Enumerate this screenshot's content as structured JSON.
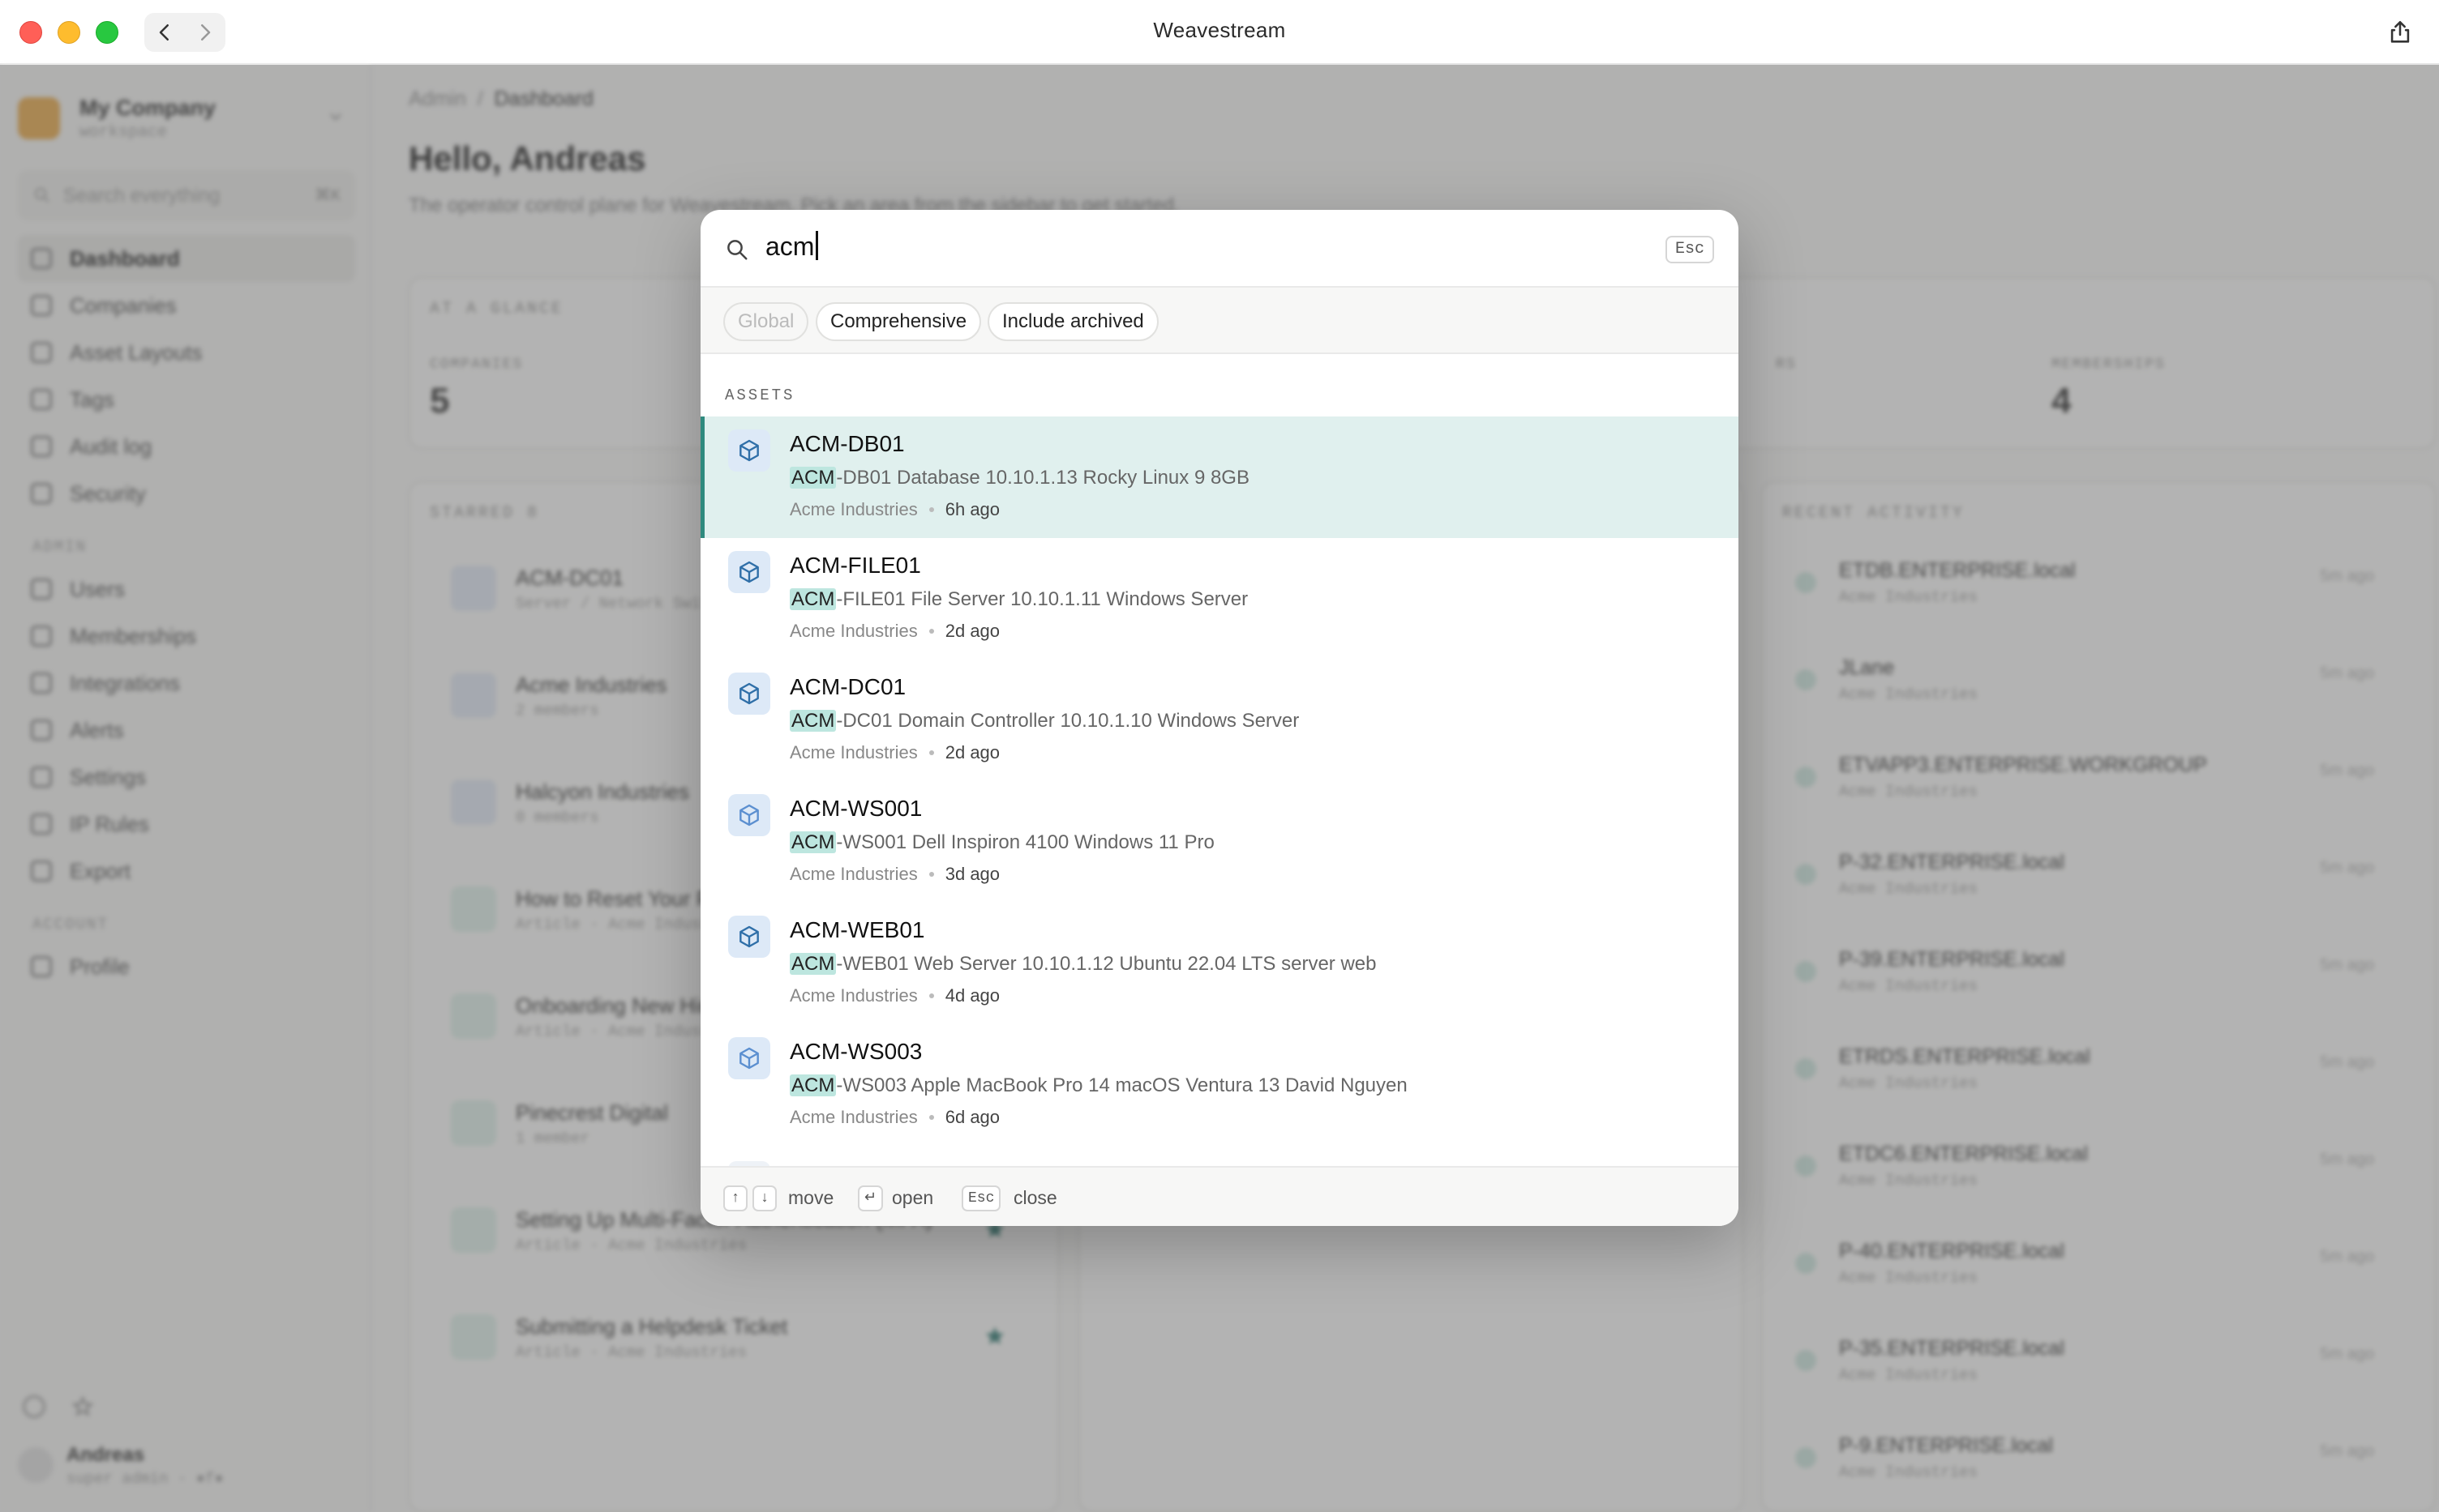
{
  "window": {
    "title": "Weavestream"
  },
  "sidebar": {
    "company_name": "My Company",
    "company_sub": "workspace",
    "search_placeholder": "Search everything",
    "search_shortcut": "⌘K",
    "items": [
      {
        "label": "Dashboard"
      },
      {
        "label": "Companies"
      },
      {
        "label": "Asset Layouts"
      },
      {
        "label": "Tags"
      },
      {
        "label": "Audit log"
      },
      {
        "label": "Security"
      }
    ],
    "admin_section": "ADMIN",
    "admin_items": [
      {
        "label": "Users"
      },
      {
        "label": "Memberships"
      },
      {
        "label": "Integrations"
      },
      {
        "label": "Alerts"
      },
      {
        "label": "Settings"
      },
      {
        "label": "IP Rules"
      },
      {
        "label": "Export"
      }
    ],
    "account_section": "ACCOUNT",
    "account_items": [
      {
        "label": "Profile"
      }
    ],
    "user_name": "Andreas",
    "user_role": "super admin · ●f●"
  },
  "main": {
    "breadcrumb_root": "Admin",
    "breadcrumb_current": "Dashboard",
    "greeting": "Hello, Andreas",
    "intro": "The operator control plane for Weavestream. Pick an area from the sidebar to get started.",
    "at_a_glance": "AT A GLANCE",
    "stats": [
      {
        "label": "COMPANIES",
        "value": "5"
      },
      {
        "label": "MEMBERSHIPS",
        "value": "4"
      }
    ],
    "stats_partial_label": "RS",
    "starred_label": "STARRED 8",
    "starred": [
      {
        "title": "ACM-DC01",
        "sub": "Server / Network Switch"
      },
      {
        "title": "Acme Industries",
        "sub": "2 members"
      },
      {
        "title": "Halcyon Industries",
        "sub": "0 members"
      },
      {
        "title": "How to Reset Your Password",
        "sub": "Article · Acme Industries"
      },
      {
        "title": "Onboarding New Hires",
        "sub": "Article · Acme Industries"
      },
      {
        "title": "Pinecrest Digital",
        "sub": "1 member"
      },
      {
        "title": "Setting Up Multi-Factor Authentication (MFA)",
        "sub": "Article · Acme Industries"
      },
      {
        "title": "Submitting a Helpdesk Ticket",
        "sub": "Article · Acme Industries"
      }
    ],
    "recent_label": "RECENT ACTIVITY",
    "recent": [
      {
        "title": "ETDB.ENTERPRISE.local",
        "sub": "Acme Industries",
        "ago": "5m ago"
      },
      {
        "title": "JLane",
        "sub": "Acme Industries",
        "ago": "5m ago"
      },
      {
        "title": "ETVAPP3.ENTERPRISE.WORKGROUP",
        "sub": "Acme Industries",
        "ago": "5m ago"
      },
      {
        "title": "P-32.ENTERPRISE.local",
        "sub": "Acme Industries",
        "ago": "5m ago"
      },
      {
        "title": "P-39.ENTERPRISE.local",
        "sub": "Acme Industries",
        "ago": "5m ago"
      },
      {
        "title": "ETRDS.ENTERPRISE.local",
        "sub": "Acme Industries",
        "ago": "5m ago"
      },
      {
        "title": "ETDC6.ENTERPRISE.local",
        "sub": "Acme Industries",
        "ago": "5m ago"
      },
      {
        "title": "P-40.ENTERPRISE.local",
        "sub": "Acme Industries",
        "ago": "5m ago"
      },
      {
        "title": "P-35.ENTERPRISE.local",
        "sub": "Acme Industries",
        "ago": "5m ago"
      },
      {
        "title": "P-9.ENTERPRISE.local",
        "sub": "Acme Industries",
        "ago": "5m ago"
      }
    ]
  },
  "palette": {
    "query": "acm",
    "esc_label": "Esc",
    "filters": [
      {
        "label": "Global",
        "disabled": true
      },
      {
        "label": "Comprehensive",
        "disabled": false
      },
      {
        "label": "Include archived",
        "disabled": false
      }
    ],
    "group_label": "ASSETS",
    "highlight": "ACM",
    "results": [
      {
        "title": "ACM-DB01",
        "desc_rest": "-DB01 Database 10.10.1.13 Rocky Linux 9 8GB",
        "company": "Acme Industries",
        "ago": "6h ago",
        "selected": true
      },
      {
        "title": "ACM-FILE01",
        "desc_rest": "-FILE01 File Server 10.10.1.11 Windows Server",
        "company": "Acme Industries",
        "ago": "2d ago",
        "selected": false
      },
      {
        "title": "ACM-DC01",
        "desc_rest": "-DC01 Domain Controller 10.10.1.10 Windows Server",
        "company": "Acme Industries",
        "ago": "2d ago",
        "selected": false
      },
      {
        "title": "ACM-WS001",
        "desc_rest": "-WS001 Dell Inspiron 4100 Windows 11 Pro",
        "company": "Acme Industries",
        "ago": "3d ago",
        "selected": false
      },
      {
        "title": "ACM-WEB01",
        "desc_rest": "-WEB01 Web Server 10.10.1.12 Ubuntu 22.04 LTS server web",
        "company": "Acme Industries",
        "ago": "4d ago",
        "selected": false
      },
      {
        "title": "ACM-WS003",
        "desc_rest": "-WS003 Apple MacBook Pro 14 macOS Ventura 13 David Nguyen",
        "company": "Acme Industries",
        "ago": "6d ago",
        "selected": false
      }
    ],
    "footer": {
      "up_key": "↑",
      "down_key": "↓",
      "move_label": "move",
      "enter_key": "↵",
      "open_label": "open",
      "esc_key": "Esc",
      "close_label": "close"
    }
  },
  "colors": {
    "accent": "#2f8a7e",
    "selected_bg": "#e0f0ee",
    "highlight_bg": "#bde6df"
  }
}
